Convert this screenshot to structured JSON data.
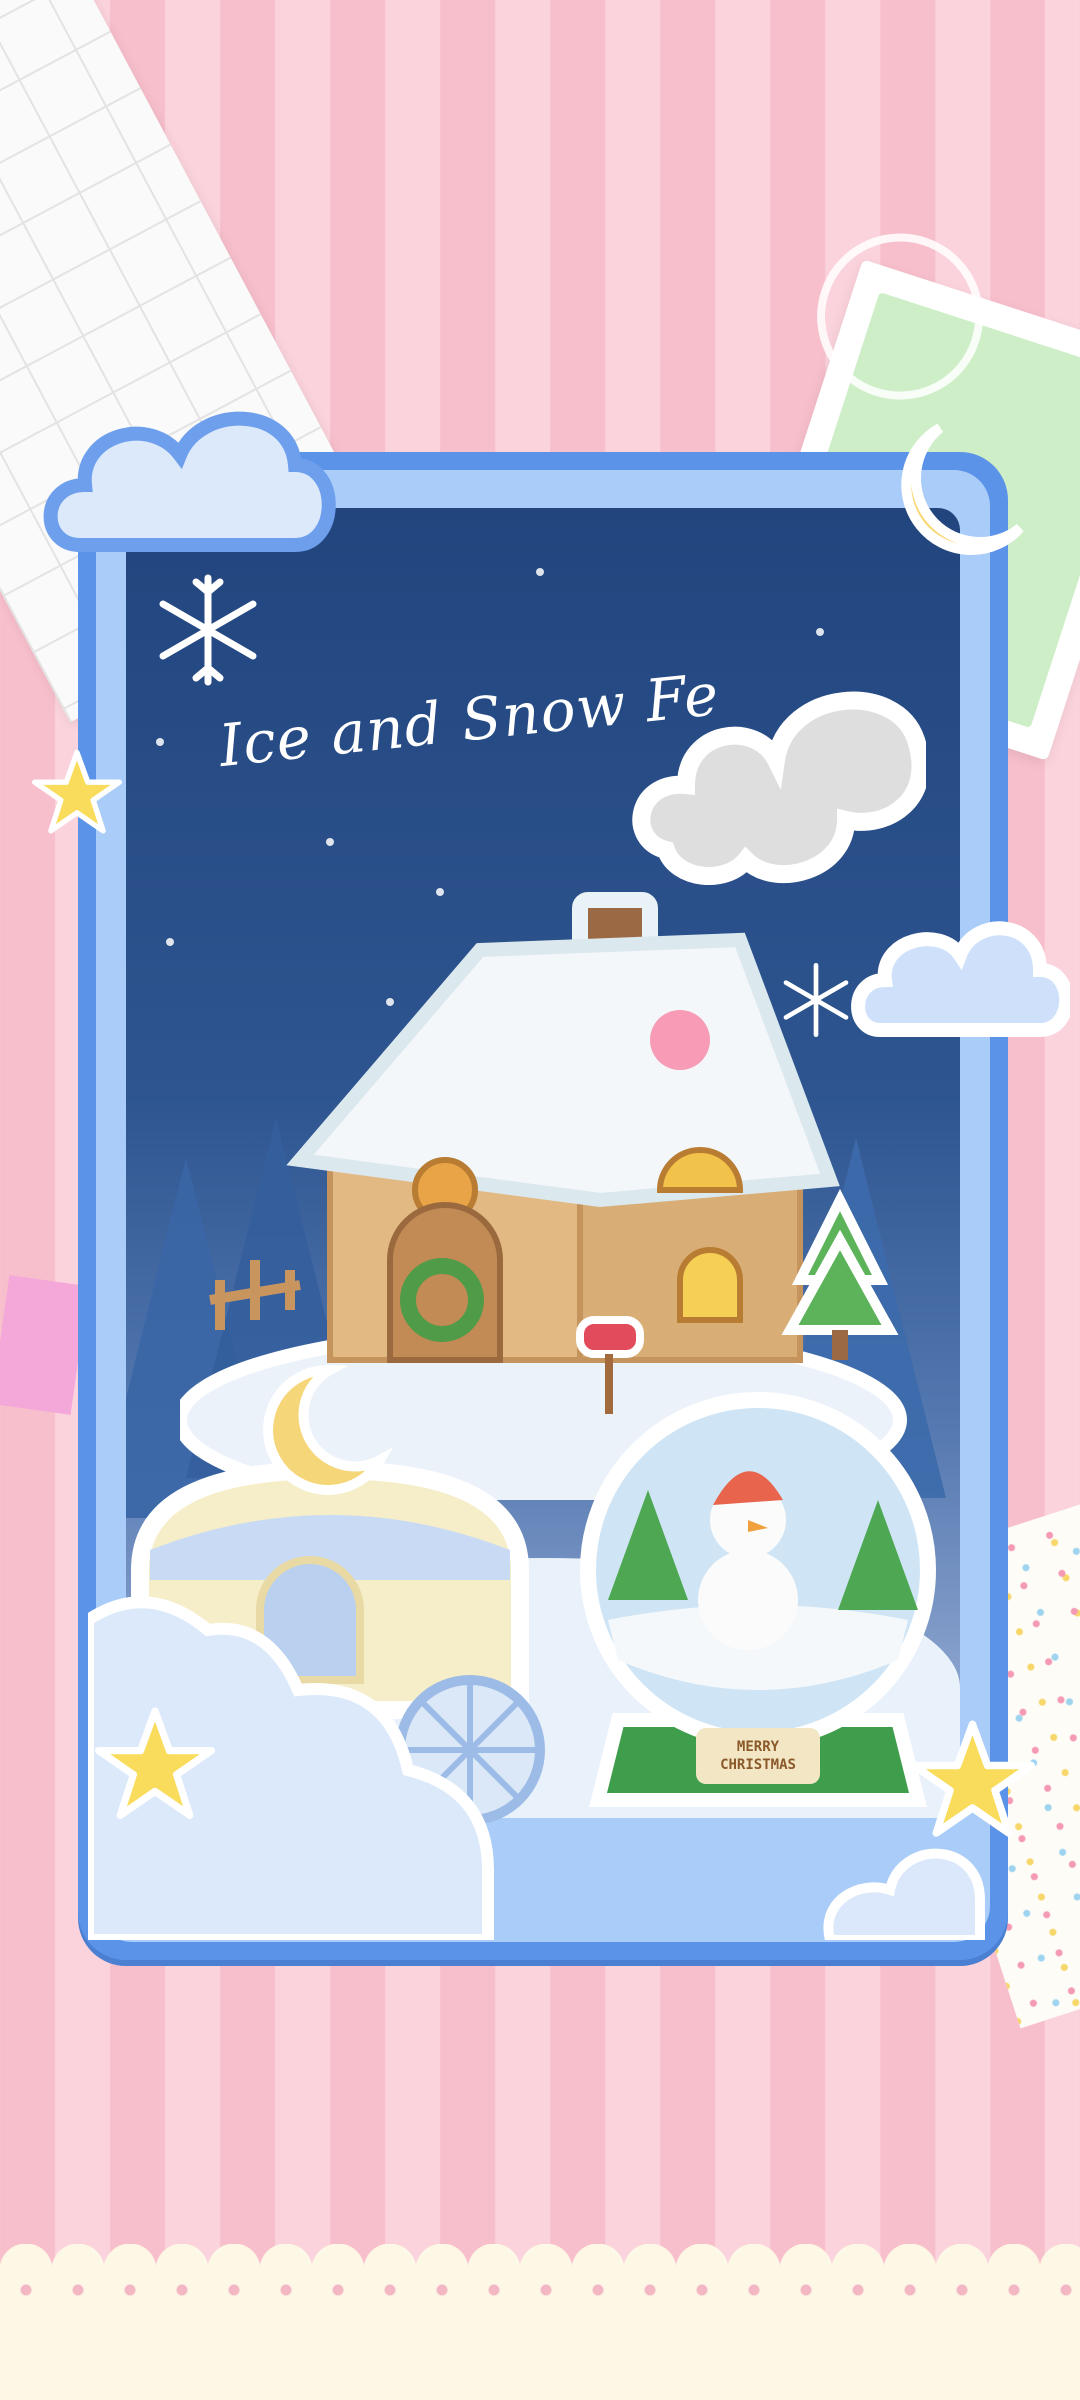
{
  "card": {
    "title": "Ice and Snow Fe"
  },
  "globe": {
    "plaque_line1": "MERRY",
    "plaque_line2": "CHRISTMAS"
  },
  "colors": {
    "background_stripe_a": "#f7bfcb",
    "background_stripe_b": "#fbd3dc",
    "frame_blue": "#5b93e8",
    "sky_top": "#22457e",
    "star_yellow": "#f9dc5c",
    "globe_base_green": "#3f9e4b"
  },
  "icons": [
    "cloud-icon",
    "moon-icon",
    "star-icon",
    "snowflake-icon",
    "gingerbread-house",
    "carriage",
    "snow-globe",
    "smoke-cloud"
  ]
}
